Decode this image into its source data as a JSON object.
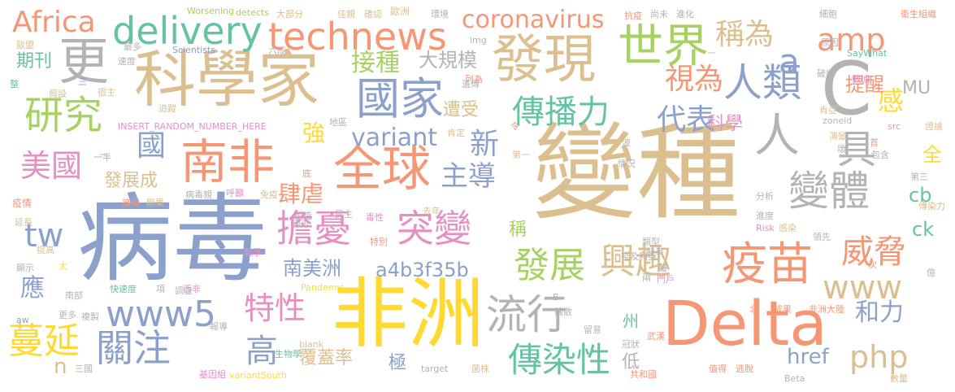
{
  "colors": {
    "tan": "#dcbf8f",
    "orange": "#f59675",
    "blue": "#8ca0cc",
    "green": "#a6d262",
    "pink": "#e58fc3",
    "yellow": "#ffd92f",
    "gray": "#b3b3b3",
    "teal": "#66c2a5"
  },
  "words": [
    "變種",
    "病毒",
    "非洲",
    "Delta",
    "科學家",
    "發現",
    "全球",
    "南非",
    "疫苗",
    "更",
    "世界",
    "人類",
    "國家",
    "technews",
    "delivery",
    "coronavirus",
    "Africa",
    "amp",
    "變體",
    "突變",
    "擔憂",
    "流行",
    "傳染性",
    "關注",
    "發展",
    "興趣",
    "威脅",
    "研究",
    "美國",
    "特性",
    "傳播力",
    "www5",
    "www",
    "php",
    "蔓延",
    "人",
    "具",
    "C",
    "a",
    "tw",
    "稱為",
    "視為",
    "接種",
    "代表",
    "主導",
    "variant",
    "a4b3f35b",
    "南美洲",
    "肆虐",
    "國",
    "新",
    "高",
    "和力",
    "感",
    "提醒",
    "大規模",
    "遭受",
    "應",
    "覆蓋率",
    "發展成",
    "強",
    "期刊",
    "科學",
    "href",
    "cb",
    "ck",
    "MU",
    "全",
    "低",
    "極",
    "稱",
    "州",
    "n",
    "Worsening",
    "detects",
    "大部分",
    "佳親",
    "確認",
    "歐洲",
    "環境",
    "抗疫",
    "尚未",
    "進化",
    "細胞",
    "衛生組織",
    "歐盟",
    "六成",
    "最多",
    "Scientists",
    "速度",
    "img",
    "證據",
    "遺傳",
    "原因",
    "SayWhat",
    "INSERT_RANDOM_NUMBER_HERE",
    "肯定",
    "地區",
    "假設",
    "宿主",
    "列為",
    "破壞",
    "數據",
    "追蹤",
    "肯亞",
    "zoneid",
    "演變",
    "壞",
    "src",
    "包含",
    "第一",
    "一半",
    "首",
    "波",
    "第三",
    "情況",
    "底",
    "分析",
    "疫情",
    "病毒親",
    "免疫",
    "呼籲",
    "民主",
    "毒性",
    "去年",
    "進度",
    "傳染力",
    "提高",
    "延長",
    "擁帶",
    "剛果",
    "創造",
    "東非",
    "特別",
    "Risk",
    "感染",
    "戰爭",
    "類型",
    "競爭",
    "領先",
    "太",
    "顯示",
    "奈及利亞",
    "次",
    "億",
    "門戶",
    "快速度",
    "項",
    "西非",
    "調查",
    "Pandemic",
    "南部",
    "更多",
    "複製",
    "擴散",
    "北",
    "成果",
    "非洲大陸",
    "aw",
    "報導",
    "留意",
    "冠狀",
    "武漢",
    "三國",
    "生物學",
    "blank",
    "target",
    "菌株",
    "基因組",
    "variantSouth",
    "共和國",
    "值得",
    "逃脫",
    "Beta",
    "數量",
    "整",
    "三",
    "令",
    "一",
    "B",
    "饅",
    "兩",
    "ㄧ"
  ]
}
